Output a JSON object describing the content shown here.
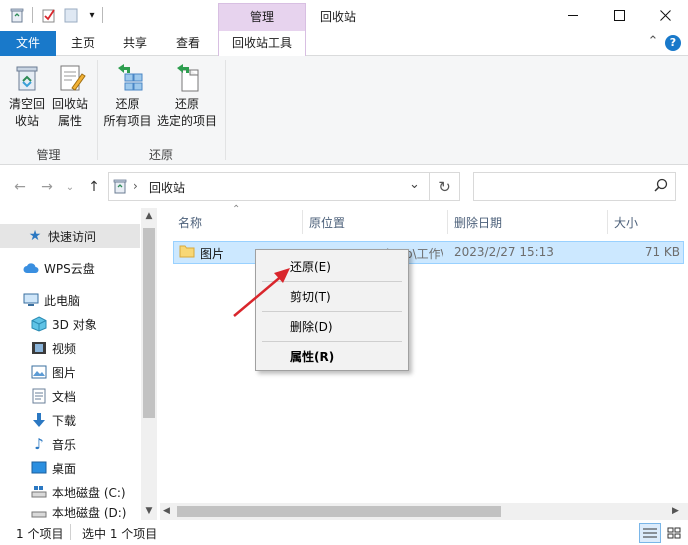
{
  "window": {
    "title": "回收站",
    "context_tab_header": "管理",
    "controls": [
      "minimize",
      "maximize",
      "close"
    ]
  },
  "ribbon_tabs": {
    "file": "文件",
    "home": "主页",
    "share": "共享",
    "view": "查看",
    "recycle_tools": "回收站工具"
  },
  "ribbon": {
    "empty_line1": "清空回",
    "empty_line2": "收站",
    "props_line1": "回收站",
    "props_line2": "属性",
    "restore_all_line1": "还原",
    "restore_all_line2": "所有项目",
    "restore_sel_line1": "还原",
    "restore_sel_line2": "选定的项目",
    "group_manage": "管理",
    "group_restore": "还原"
  },
  "address": {
    "location": "回收站",
    "separator": "›",
    "search_placeholder": ""
  },
  "nav": {
    "quick_access": "快速访问",
    "wps_cloud": "WPS云盘",
    "this_pc": "此电脑",
    "objects_3d": "3D 对象",
    "videos": "视频",
    "pictures": "图片",
    "documents": "文档",
    "downloads": "下载",
    "music": "音乐",
    "desktop": "桌面",
    "local_c": "本地磁盘 (C:)",
    "local_d": "本地磁盘 (D:)"
  },
  "columns": {
    "name": "名称",
    "original_location": "原位置",
    "date_deleted": "删除日期",
    "size": "大小"
  },
  "files": [
    {
      "name": "图片",
      "original_location": "C:\\Users\\Desktop\\工作\\详情...",
      "date_deleted": "2023/2/27 15:13",
      "size": "71 KB"
    }
  ],
  "context_menu": {
    "restore": "还原(E)",
    "cut": "剪切(T)",
    "delete": "删除(D)",
    "properties": "属性(R)"
  },
  "status": {
    "item_count": "1 个项目",
    "selected": "选中 1 个项目"
  },
  "colors": {
    "accent": "#1979ca",
    "context_tab": "#e7d3ee",
    "selection": "#cce8ff",
    "annotation_arrow": "#d9262c"
  }
}
